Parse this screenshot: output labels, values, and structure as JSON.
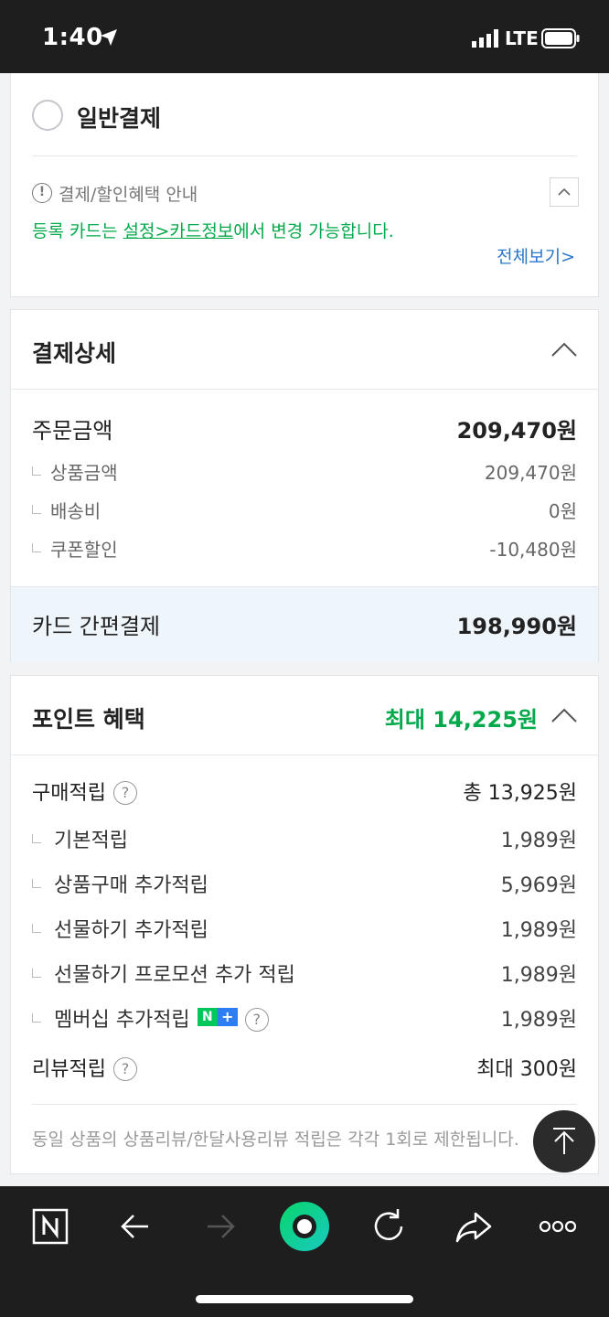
{
  "status_bar": {
    "time": "1:40",
    "network": "LTE"
  },
  "payment_option": {
    "label": "일반결제"
  },
  "benefit_info": {
    "title": "결제/할인혜택 안내",
    "text_prefix": "등록 카드는 ",
    "text_link": "설정>카드정보",
    "text_suffix": "에서 변경 가능합니다.",
    "view_all": "전체보기>"
  },
  "payment_detail": {
    "title": "결제상세",
    "order_amount_label": "주문금액",
    "order_amount_value": "209,470원",
    "items": [
      {
        "label": "상품금액",
        "value": "209,470원"
      },
      {
        "label": "배송비",
        "value": "0원"
      },
      {
        "label": "쿠폰할인",
        "value": "-10,480원"
      }
    ],
    "total_label": "카드 간편결제",
    "total_value": "198,990원"
  },
  "points": {
    "title": "포인트 혜택",
    "max_value": "최대 14,225원",
    "purchase_label": "구매적립",
    "purchase_value": "총 13,925원",
    "items": [
      {
        "label": "기본적립",
        "value": "1,989원"
      },
      {
        "label": "상품구매 추가적립",
        "value": "5,969원"
      },
      {
        "label": "선물하기 추가적립",
        "value": "1,989원"
      },
      {
        "label": "선물하기 프로모션 추가 적립",
        "value": "1,989원"
      },
      {
        "label": "멤버십 추가적립",
        "value": "1,989원"
      }
    ],
    "review_label": "리뷰적립",
    "review_value": "최대 300원",
    "note": "동일 상품의 상품리뷰/한달사용리뷰 적립은 각각 1회로 제한됩니다."
  },
  "colors": {
    "accent_green": "#03a94a",
    "link_blue": "#2a78c9",
    "dark_bar": "#1e1e1e"
  }
}
